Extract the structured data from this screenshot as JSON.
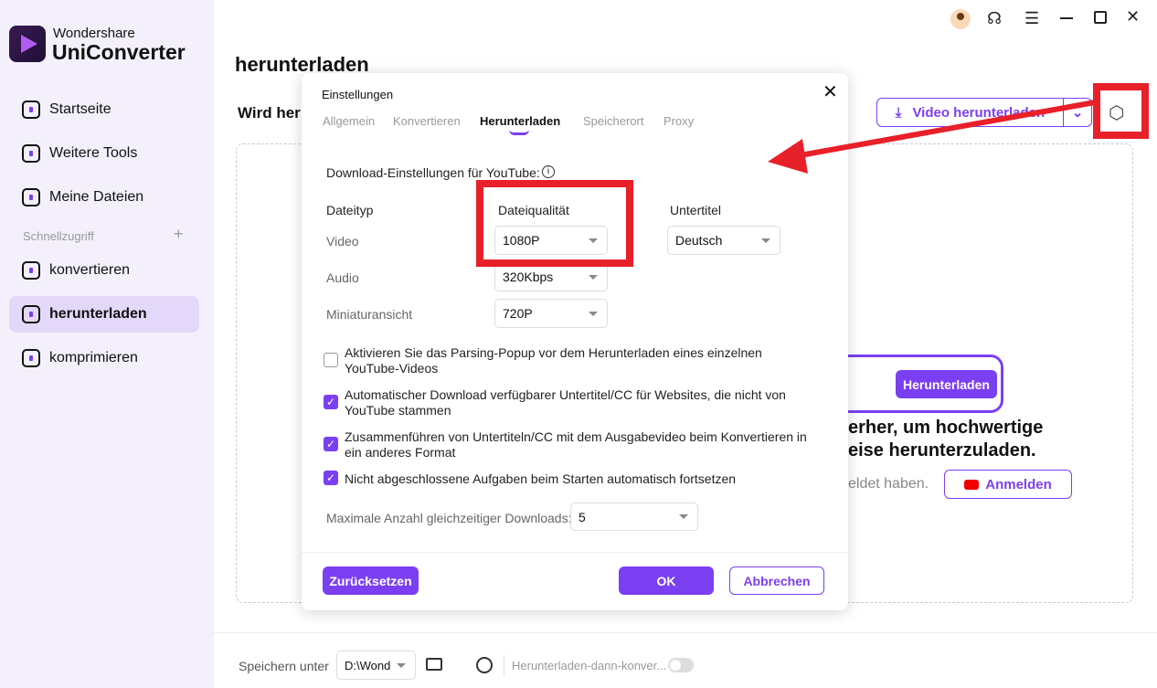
{
  "app": {
    "brand_line1": "Wondershare",
    "brand_line2": "UniConverter"
  },
  "sidebar": {
    "items": [
      {
        "label": "Startseite"
      },
      {
        "label": "Weitere Tools"
      },
      {
        "label": "Meine Dateien"
      }
    ],
    "quick_access": "Schnellzugriff",
    "quick_add": "+",
    "quick_items": [
      {
        "label": "konvertieren"
      },
      {
        "label": "herunterladen",
        "active": true
      },
      {
        "label": "komprimieren"
      }
    ]
  },
  "header": {
    "title": "herunterladen",
    "subtitle": "Wird her",
    "download_btn": "Video herunterladen"
  },
  "background": {
    "paste_btn": "Herunterladen",
    "line1": "erher, um hochwertige",
    "line2": "eise herunterzuladen.",
    "line3": "eldet haben.",
    "login_btn": "Anmelden",
    "dot": "·"
  },
  "dialog": {
    "title": "Einstellungen",
    "tabs": [
      "Allgemein",
      "Konvertieren",
      "Herunterladen",
      "Speicherort",
      "Proxy"
    ],
    "active_tab": "Herunterladen",
    "section": "Download-Einstellungen für YouTube:",
    "info_icon": "i",
    "col_type": "Dateityp",
    "col_quality": "Dateiqualität",
    "col_subtitle": "Untertitel",
    "rows": [
      {
        "label": "Video",
        "value": "1080P"
      },
      {
        "label": "Audio",
        "value": "320Kbps"
      },
      {
        "label": "Miniaturansicht",
        "value": "720P"
      }
    ],
    "subtitle_value": "Deutsch",
    "checkboxes": [
      {
        "label": "Aktivieren Sie das Parsing-Popup vor dem Herunterladen eines einzelnen YouTube-Videos",
        "checked": false
      },
      {
        "label": "Automatischer Download verfügbarer Untertitel/CC für Websites, die nicht von YouTube stammen",
        "checked": true
      },
      {
        "label": "Zusammenführen von Untertiteln/CC mit dem Ausgabevideo beim Konvertieren in ein anderes Format",
        "checked": true
      },
      {
        "label": "Nicht abgeschlossene Aufgaben beim Starten automatisch fortsetzen",
        "checked": true
      }
    ],
    "max_label": "Maximale Anzahl gleichzeitiger Downloads:",
    "max_value": "5",
    "reset": "Zurücksetzen",
    "ok": "OK",
    "cancel": "Abbrechen"
  },
  "footer": {
    "save_label": "Speichern unter",
    "path": "D:\\Wond",
    "convert_label": "Herunterladen-dann-konver...",
    "convert_toggle": false
  },
  "colors": {
    "accent": "#7b3ff2",
    "annotation": "#e8202a",
    "sidebar_bg": "#f3f0fb"
  }
}
